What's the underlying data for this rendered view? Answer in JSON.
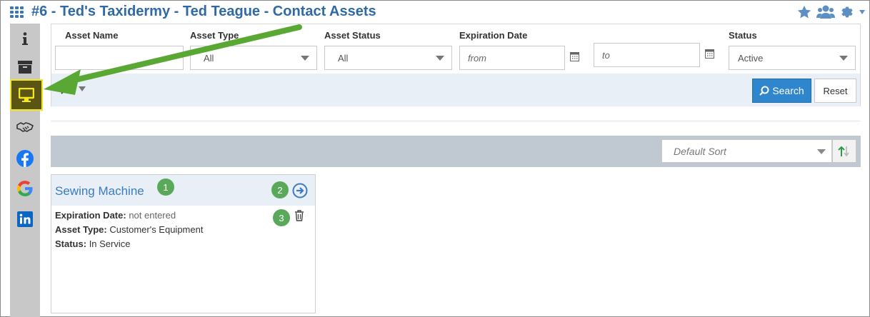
{
  "header": {
    "title": "#6 - Ted's Taxidermy - Ted Teague - Contact Assets"
  },
  "rail": {
    "items": [
      "info",
      "archive",
      "assets",
      "deals",
      "facebook",
      "google",
      "linkedin"
    ],
    "active": "assets"
  },
  "filters": {
    "asset_name": {
      "label": "Asset Name",
      "value": ""
    },
    "asset_type": {
      "label": "Asset Type",
      "value": "All"
    },
    "asset_status": {
      "label": "Asset Status",
      "value": "All"
    },
    "expiration": {
      "label": "Expiration Date",
      "from_placeholder": "from",
      "to_placeholder": "to"
    },
    "status": {
      "label": "Status",
      "value": "Active"
    },
    "search_label": "Search",
    "reset_label": "Reset"
  },
  "sort": {
    "value": "Default Sort"
  },
  "card": {
    "title": "Sewing Machine",
    "fields": [
      {
        "label": "Expiration Date:",
        "value": "not entered"
      },
      {
        "label": "Asset Type:",
        "value": "Customer's Equipment"
      },
      {
        "label": "Status:",
        "value": "In Service"
      }
    ],
    "badges": [
      "1",
      "2",
      "3"
    ]
  },
  "colors": {
    "brand_blue": "#2f6aa6",
    "button_blue": "#2f86cc",
    "rail_gray": "#c8c8c8",
    "highlight": "#f2e61e",
    "arrow_green": "#5aa834"
  }
}
